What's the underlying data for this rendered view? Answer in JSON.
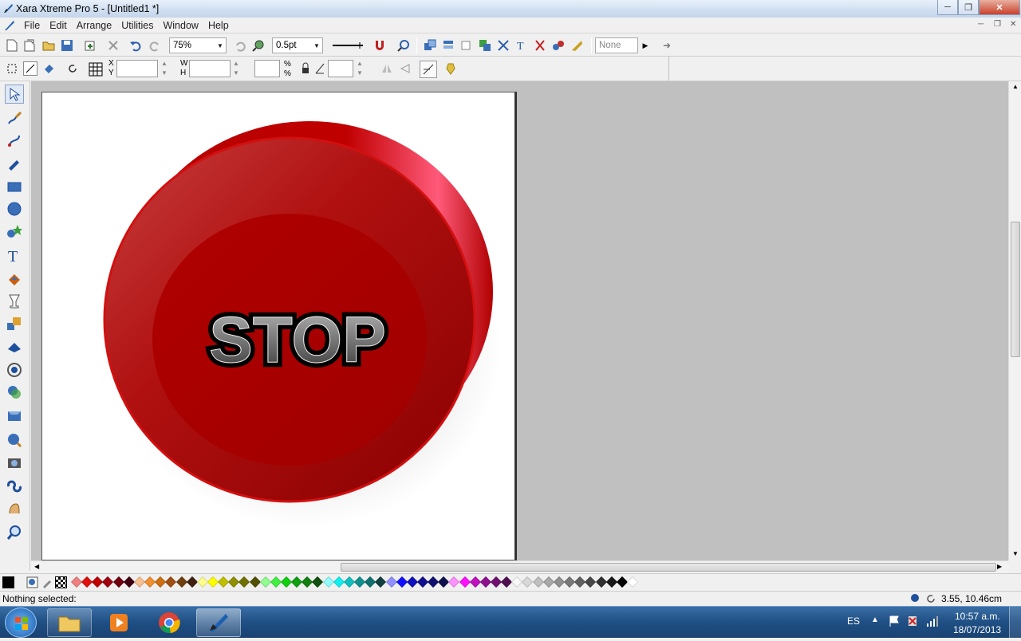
{
  "window": {
    "title": "Xara Xtreme Pro 5 - [Untitled1 *]"
  },
  "menu": {
    "items": [
      "File",
      "Edit",
      "Arrange",
      "Utilities",
      "Window",
      "Help"
    ]
  },
  "toolbar": {
    "zoom_value": "75%",
    "line_width_value": "0.5pt",
    "none_value": "None"
  },
  "infobar": {
    "x_label": "X",
    "y_label": "Y",
    "w_label": "W",
    "h_label": "H"
  },
  "document": {
    "button_text": "STOP"
  },
  "status": {
    "selection": "Nothing selected:",
    "coordinates": "3.55, 10.46cm"
  },
  "taskbar": {
    "language": "ES",
    "time": "10:57 a.m.",
    "date": "18/07/2013"
  },
  "palette": {
    "colors": [
      "#f08080",
      "#e01010",
      "#c00000",
      "#a00010",
      "#700010",
      "#400010",
      "#f8c090",
      "#f09030",
      "#d07010",
      "#a05010",
      "#704010",
      "#402010",
      "#ffff90",
      "#ffff00",
      "#c0c000",
      "#909000",
      "#707000",
      "#505000",
      "#90ff90",
      "#40f040",
      "#10d010",
      "#10a010",
      "#108010",
      "#105010",
      "#90ffff",
      "#10f0f0",
      "#10c0c0",
      "#109090",
      "#107070",
      "#104040",
      "#9090ff",
      "#1010ff",
      "#1010c0",
      "#101090",
      "#101070",
      "#101050",
      "#ff90ff",
      "#ff10ff",
      "#c010c0",
      "#901090",
      "#701070",
      "#501050",
      "#f8f8f8",
      "#d8d8d8",
      "#c0c0c0",
      "#a8a8a8",
      "#909090",
      "#787878",
      "#606060",
      "#484848",
      "#303030",
      "#181818",
      "#000000",
      "#ffffff"
    ]
  },
  "colors": {
    "accent_red": "#c40000",
    "canvas_bg": "#c0c0c0"
  }
}
